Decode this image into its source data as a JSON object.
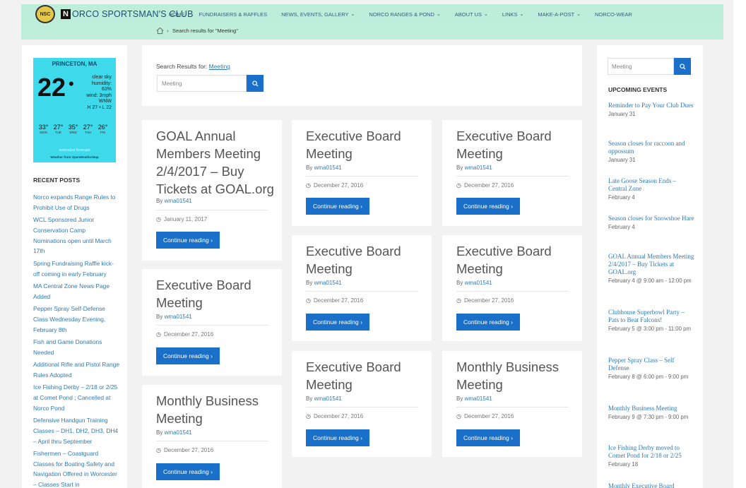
{
  "header": {
    "logo_badge": "NSC",
    "logo_letter": "N",
    "site_name": "ORCO SPORTSMAN'S CLUB",
    "nav": [
      {
        "label": "HOME",
        "dropdown": false
      },
      {
        "label": "FUNDRAISERS & RAFFLES",
        "dropdown": false
      },
      {
        "label": "NEWS, EVENTS, GALLERY",
        "dropdown": true
      },
      {
        "label": "NORCO RANGES & POND",
        "dropdown": true
      },
      {
        "label": "ABOUT US",
        "dropdown": true
      },
      {
        "label": "LINKS",
        "dropdown": true
      },
      {
        "label": "MAKE-A-POST",
        "dropdown": true
      },
      {
        "label": "NORCO-WEAR",
        "dropdown": false
      }
    ]
  },
  "breadcrumb": {
    "home_icon": "home-icon",
    "separator": "›",
    "text": "Search results for \"Meeting\""
  },
  "weather": {
    "city": "PRINCETON, MA",
    "temp": "22",
    "deg": "•",
    "conditions": [
      "clear sky",
      "humidity:",
      "63%",
      "wind: 3mph",
      "WNW",
      "H 27 • L 22"
    ],
    "forecast": [
      {
        "temp": "33°",
        "day": "MON"
      },
      {
        "temp": "27°",
        "day": "TUE"
      },
      {
        "temp": "35°",
        "day": "WED"
      },
      {
        "temp": "27°",
        "day": "THU"
      },
      {
        "temp": "26°",
        "day": "FRI"
      }
    ],
    "extended": "extended forecast",
    "credit": "Weather from OpenWeatherMap"
  },
  "recent_posts": {
    "title": "RECENT POSTS",
    "items": [
      "Norco expands Range Rules to Prohibit Use of Drugs",
      "WCL Sponsored Junior Conservation Camp Nominations open until March 17th",
      "Spring Fundraising Raffle kick-off coming in early February",
      "MA Central Zone News Page Added",
      "Pepper Spray Self-Defense Class Wednesday Evening, February 8th",
      "Fish and Game Donations Needed",
      "Additional Rifle and Pistol Range Rules Adopted",
      "Ice Fishing Derby – 2/18 or 2/25 at Comet Pond ; Cancelled at Norco Pond",
      "Defensive Handgun Training Classes – DH1, DH2, DH3, DH4 – April thru September",
      "Fishermen – Coastguard Classes for Boating Safety and Navigation Offered in Worcester – Classes Start in"
    ]
  },
  "search": {
    "label": "Search Results for:",
    "term": "Meeting",
    "value": "Meeting",
    "button_icon": "search-icon"
  },
  "posts": [
    {
      "title": "GOAL Annual Members Meeting 2/4/2017 – Buy Tickets at GOAL.org",
      "by": "By",
      "author": "wma01541",
      "date": "January 11, 2017",
      "button": "Continue reading  ›"
    },
    {
      "title": "Executive Board Meeting",
      "by": "By",
      "author": "wma01541",
      "date": "December 27, 2016",
      "button": "Continue reading  ›"
    },
    {
      "title": "Executive Board Meeting",
      "by": "By",
      "author": "wma01541",
      "date": "December 27, 2016",
      "button": "Continue reading  ›"
    },
    {
      "title": "Executive Board Meeting",
      "by": "By",
      "author": "wma01541",
      "date": "December 27, 2016",
      "button": "Continue reading  ›"
    },
    {
      "title": "Executive Board Meeting",
      "by": "By",
      "author": "wma01541",
      "date": "December 27, 2016",
      "button": "Continue reading  ›"
    },
    {
      "title": "Executive Board Meeting",
      "by": "By",
      "author": "wma01541",
      "date": "December 27, 2016",
      "button": "Continue reading  ›"
    },
    {
      "title": "Executive Board Meeting",
      "by": "By",
      "author": "wma01541",
      "date": "December 27, 2016",
      "button": "Continue reading  ›"
    },
    {
      "title": "Monthly Business Meeting",
      "by": "By",
      "author": "wma01541",
      "date": "December 27, 2016",
      "button": "Continue reading  ›"
    },
    {
      "title": "Monthly Business Meeting",
      "by": "By",
      "author": "wma01541",
      "date": "December 27, 2016",
      "button": "Continue reading  ›"
    }
  ],
  "sidebar_search": {
    "value": "Meeting",
    "button_icon": "search-icon"
  },
  "upcoming_events": {
    "title": "UPCOMING EVENTS",
    "items": [
      {
        "name": "Reminder to Pay Your Club Dues",
        "date": "January 31"
      },
      {
        "name": "Season closes for raccoon and oppossum",
        "date": "January 31"
      },
      {
        "name": "Late Goose Season Ends – Central Zone",
        "date": "February 4"
      },
      {
        "name": "Season closes for Snowshoe Hare",
        "date": "February 4"
      },
      {
        "name": "GOAL Annual Members Meeting 2/4/2017 – Buy Tickets at GOAL.org",
        "date": "February 4 @ 9:00 am - 12:00 pm"
      },
      {
        "name": "Clubhouse Superbowl Party – Pats to Beat Falcons!",
        "date": "February 5 @ 3:00 pm - 11:00 pm"
      },
      {
        "name": "Pepper Spray Class – Self Defense",
        "date": "February 8 @ 6:00 pm - 9:00 pm"
      },
      {
        "name": "Monthly Business Meeting",
        "date": "February 9 @ 7:30 pm - 9:00 pm"
      },
      {
        "name": "Ice Fishing Derby moved to Comet Pond for 2/18 or 2/25",
        "date": "February 18"
      },
      {
        "name": "Monthly Executive Board",
        "date": ""
      }
    ]
  }
}
